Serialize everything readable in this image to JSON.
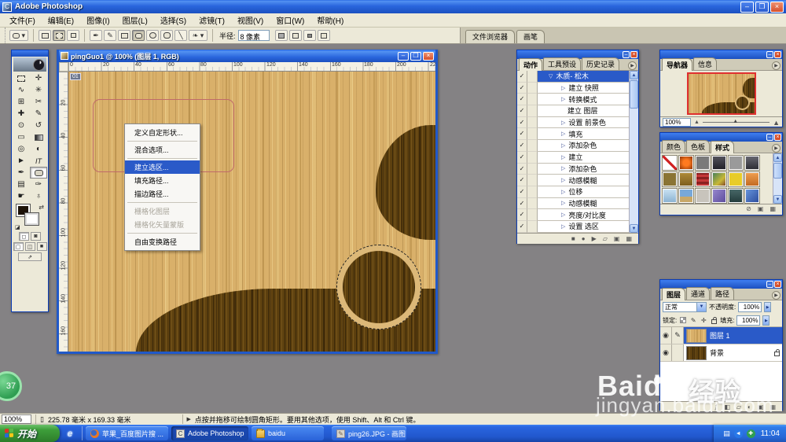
{
  "app": {
    "title": "Adobe Photoshop"
  },
  "icons": {
    "check": "✓",
    "combo_arrow": "▼",
    "spin_arrow": "▶",
    "eye": "◉",
    "brush_edit": "✎",
    "panel_menu": "▶",
    "scroll_up": "▲",
    "scroll_down": "▼",
    "btn_min": "–",
    "btn_restore": "❐",
    "btn_close": "×",
    "stop": "■",
    "record": "●",
    "play": "▶",
    "folder": "▱",
    "new_item": "▣",
    "trash": "▦",
    "clear_style": "⊘",
    "mountain": "▲",
    "slider_thumb": "▲",
    "fx": "ƒ",
    "mask": "◧",
    "adjust": "◐",
    "doc_icon": "▯",
    "hint_arrow": "▶",
    "ie": "e",
    "lock_move": "✛",
    "lock_brush": "✎",
    "tray_keyboard": "▤",
    "tray_blue": "◄",
    "tray_green": "✚"
  },
  "menu": {
    "items": [
      {
        "label": "文件(F)"
      },
      {
        "label": "编辑(E)"
      },
      {
        "label": "图像(I)"
      },
      {
        "label": "图层(L)"
      },
      {
        "label": "选择(S)"
      },
      {
        "label": "滤镜(T)"
      },
      {
        "label": "视图(V)"
      },
      {
        "label": "窗口(W)"
      },
      {
        "label": "帮助(H)"
      }
    ]
  },
  "options": {
    "radius_label": "半径:",
    "radius_value": "8 像素",
    "palette_tabs": [
      {
        "label": "文件浏览器"
      },
      {
        "label": "画笔"
      }
    ]
  },
  "toolbox": {
    "tools": [
      {
        "name": "rectangular-marquee-tool",
        "glyph": ""
      },
      {
        "name": "move-tool",
        "glyph": "✛"
      },
      {
        "name": "lasso-tool",
        "glyph": "∿"
      },
      {
        "name": "magic-wand-tool",
        "glyph": "✳"
      },
      {
        "name": "crop-tool",
        "glyph": "⊞"
      },
      {
        "name": "slice-tool",
        "glyph": "✂"
      },
      {
        "name": "healing-brush-tool",
        "glyph": "✚"
      },
      {
        "name": "brush-tool",
        "glyph": "✎"
      },
      {
        "name": "clone-stamp-tool",
        "glyph": "⊙"
      },
      {
        "name": "history-brush-tool",
        "glyph": "↺"
      },
      {
        "name": "eraser-tool",
        "glyph": "▭"
      },
      {
        "name": "gradient-tool",
        "glyph": ""
      },
      {
        "name": "blur-tool",
        "glyph": "◎"
      },
      {
        "name": "dodge-tool",
        "glyph": "◐"
      },
      {
        "name": "path-selection-tool",
        "glyph": "►"
      },
      {
        "name": "type-tool",
        "glyph": "IT"
      },
      {
        "name": "pen-tool",
        "glyph": "✒"
      },
      {
        "name": "rounded-rectangle-tool",
        "glyph": ""
      },
      {
        "name": "notes-tool",
        "glyph": "▤"
      },
      {
        "name": "eyedropper-tool",
        "glyph": "✑"
      },
      {
        "name": "hand-tool",
        "glyph": "☛"
      },
      {
        "name": "zoom-tool",
        "glyph": "♁"
      }
    ]
  },
  "doc": {
    "title": "pingGuo1 @ 100% (图层 1, RGB)",
    "slice_badge": "01",
    "h_ruler": [
      "0",
      "20",
      "40",
      "60",
      "80",
      "100",
      "120",
      "140",
      "160",
      "180",
      "200",
      "22"
    ],
    "v_ruler": [
      "20",
      "40",
      "60",
      "80",
      "100",
      "120",
      "140",
      "160"
    ]
  },
  "context_menu": {
    "items": [
      {
        "label": "定义自定形状...",
        "state": "normal"
      },
      {
        "label": "混合选项...",
        "state": "normal"
      },
      {
        "label": "建立选区...",
        "state": "highlighted"
      },
      {
        "label": "填充路径...",
        "state": "normal"
      },
      {
        "label": "描边路径...",
        "state": "normal"
      },
      {
        "label": "栅格化图层",
        "state": "disabled"
      },
      {
        "label": "栅格化矢量蒙版",
        "state": "disabled"
      },
      {
        "label": "自由变换路径",
        "state": "normal"
      }
    ]
  },
  "actions_panel": {
    "tabs": [
      {
        "label": "动作"
      },
      {
        "label": "工具预设"
      },
      {
        "label": "历史记录"
      }
    ],
    "rows": [
      {
        "label": "木质- 松木",
        "arrow": "▽"
      },
      {
        "label": "建立 快照",
        "arrow": "▷"
      },
      {
        "label": "转换模式",
        "arrow": "▷"
      },
      {
        "label": "建立 图层",
        "arrow": ""
      },
      {
        "label": "设置 前景色",
        "arrow": "▷"
      },
      {
        "label": "填充",
        "arrow": "▷"
      },
      {
        "label": "添加杂色",
        "arrow": "▷"
      },
      {
        "label": "建立",
        "arrow": "▷"
      },
      {
        "label": "添加杂色",
        "arrow": "▷"
      },
      {
        "label": "动感模糊",
        "arrow": "▷"
      },
      {
        "label": "位移",
        "arrow": "▷"
      },
      {
        "label": "动感模糊",
        "arrow": "▷"
      },
      {
        "label": "亮度/对比度",
        "arrow": "▷"
      },
      {
        "label": "设置 选区",
        "arrow": "▷"
      }
    ]
  },
  "navigator_panel": {
    "tabs": [
      {
        "label": "导航器"
      },
      {
        "label": "信息"
      }
    ],
    "zoom_value": "100%"
  },
  "styles_panel": {
    "tabs": [
      {
        "label": "颜色"
      },
      {
        "label": "色板"
      },
      {
        "label": "样式"
      }
    ],
    "swatches": [
      {
        "name": "no-style",
        "color": "#ffffff"
      },
      {
        "name": "orange-glow",
        "color": "radial-gradient(circle,#ff7a20 30%,#7a2800)"
      },
      {
        "name": "gray",
        "color": "#7a7a7a"
      },
      {
        "name": "dark-glossy",
        "color": "linear-gradient(180deg,#55555f,#1f1f26)"
      },
      {
        "name": "light-gray",
        "color": "#9a9a9a"
      },
      {
        "name": "dark-gradient",
        "color": "linear-gradient(180deg,#6a6a74,#2a2a32)"
      },
      {
        "name": "olive",
        "color": "#8a7434"
      },
      {
        "name": "brown",
        "color": "linear-gradient(180deg,#b08c3a,#7a5c1e)"
      },
      {
        "name": "red-stripes",
        "color": "repeating-linear-gradient(0deg,#c43838 0 3px,#8a2020 3px 6px)"
      },
      {
        "name": "multicolor",
        "color": "linear-gradient(135deg,#3a7a5a,#c8b838 60%,#7a3a2a)"
      },
      {
        "name": "yellow",
        "color": "#e8cc28"
      },
      {
        "name": "orange",
        "color": "linear-gradient(180deg,#f0a050,#c06820)"
      },
      {
        "name": "light-blue",
        "color": "linear-gradient(180deg,#cce4f4,#88b0d0)"
      },
      {
        "name": "sky-landscape",
        "color": "linear-gradient(180deg,#78a8d8 55%,#c8a868 56%)"
      },
      {
        "name": "pattern",
        "color": "#c8c4bc"
      },
      {
        "name": "purple",
        "color": "linear-gradient(135deg,#9a8ad0,#5a4a9a)"
      },
      {
        "name": "dark-teal",
        "color": "linear-gradient(180deg,#4a6a6a,#223a3a)"
      },
      {
        "name": "blue",
        "color": "linear-gradient(135deg,#6a98e0,#2a4a9a)"
      }
    ]
  },
  "layers_panel": {
    "tabs": [
      {
        "label": "图层"
      },
      {
        "label": "通道"
      },
      {
        "label": "路径"
      }
    ],
    "blend_mode": "正常",
    "opacity_label": "不透明度:",
    "opacity_value": "100%",
    "lock_label": "锁定:",
    "fill_label": "填充:",
    "fill_value": "100%",
    "layers": [
      {
        "name": "图层 1"
      },
      {
        "name": "背景"
      }
    ]
  },
  "status_bar": {
    "zoom": "100%",
    "doc_size": "225.78 毫米 x 169.33 毫米",
    "hint": "点按并拖移可绘制圆角矩形。要用其他选项，使用 Shift、Alt 和 Ctrl 键。"
  },
  "taskbar": {
    "start_label": "开始",
    "tasks": [
      {
        "label": "苹果_百度图片搜 ..."
      },
      {
        "label": "Adobe Photoshop"
      },
      {
        "label": "baidu"
      },
      {
        "label": "ping26.JPG - 画图"
      }
    ],
    "tray_time": "11:04"
  },
  "watermark": {
    "brand": "Baidu",
    "suffix": "经验",
    "url": "jingyan.baidu.com"
  },
  "screen_badge": "37",
  "colors": {
    "xp_blue": "#2157cd",
    "selection_blue": "#2a5ac8",
    "wood_light": "#d9b06a",
    "wood_dark": "#5d400f",
    "workspace_gray": "#848284"
  }
}
